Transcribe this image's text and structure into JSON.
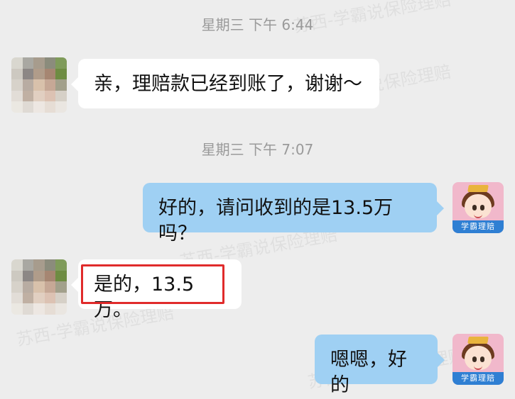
{
  "timestamps": [
    {
      "text": "星期三  下午 6:44"
    },
    {
      "text": "星期三  下午 7:07"
    }
  ],
  "messages": [
    {
      "side": "left",
      "text": "亲，理赔款已经到账了，谢谢～"
    },
    {
      "side": "right",
      "text": "好的，请问收到的是13.5万吗？"
    },
    {
      "side": "left",
      "text": "是的，13.5万。"
    },
    {
      "side": "right",
      "text": "嗯嗯，好的"
    }
  ],
  "self_avatar": {
    "badge_text": "学霸理赔"
  },
  "watermark": {
    "text": "苏西-学霸说保险理赔"
  },
  "colors": {
    "background": "#ededed",
    "bubble_left": "#ffffff",
    "bubble_right": "#9fd0f3",
    "highlight": "#e02b2b",
    "timestamp": "#9a9a9a"
  }
}
